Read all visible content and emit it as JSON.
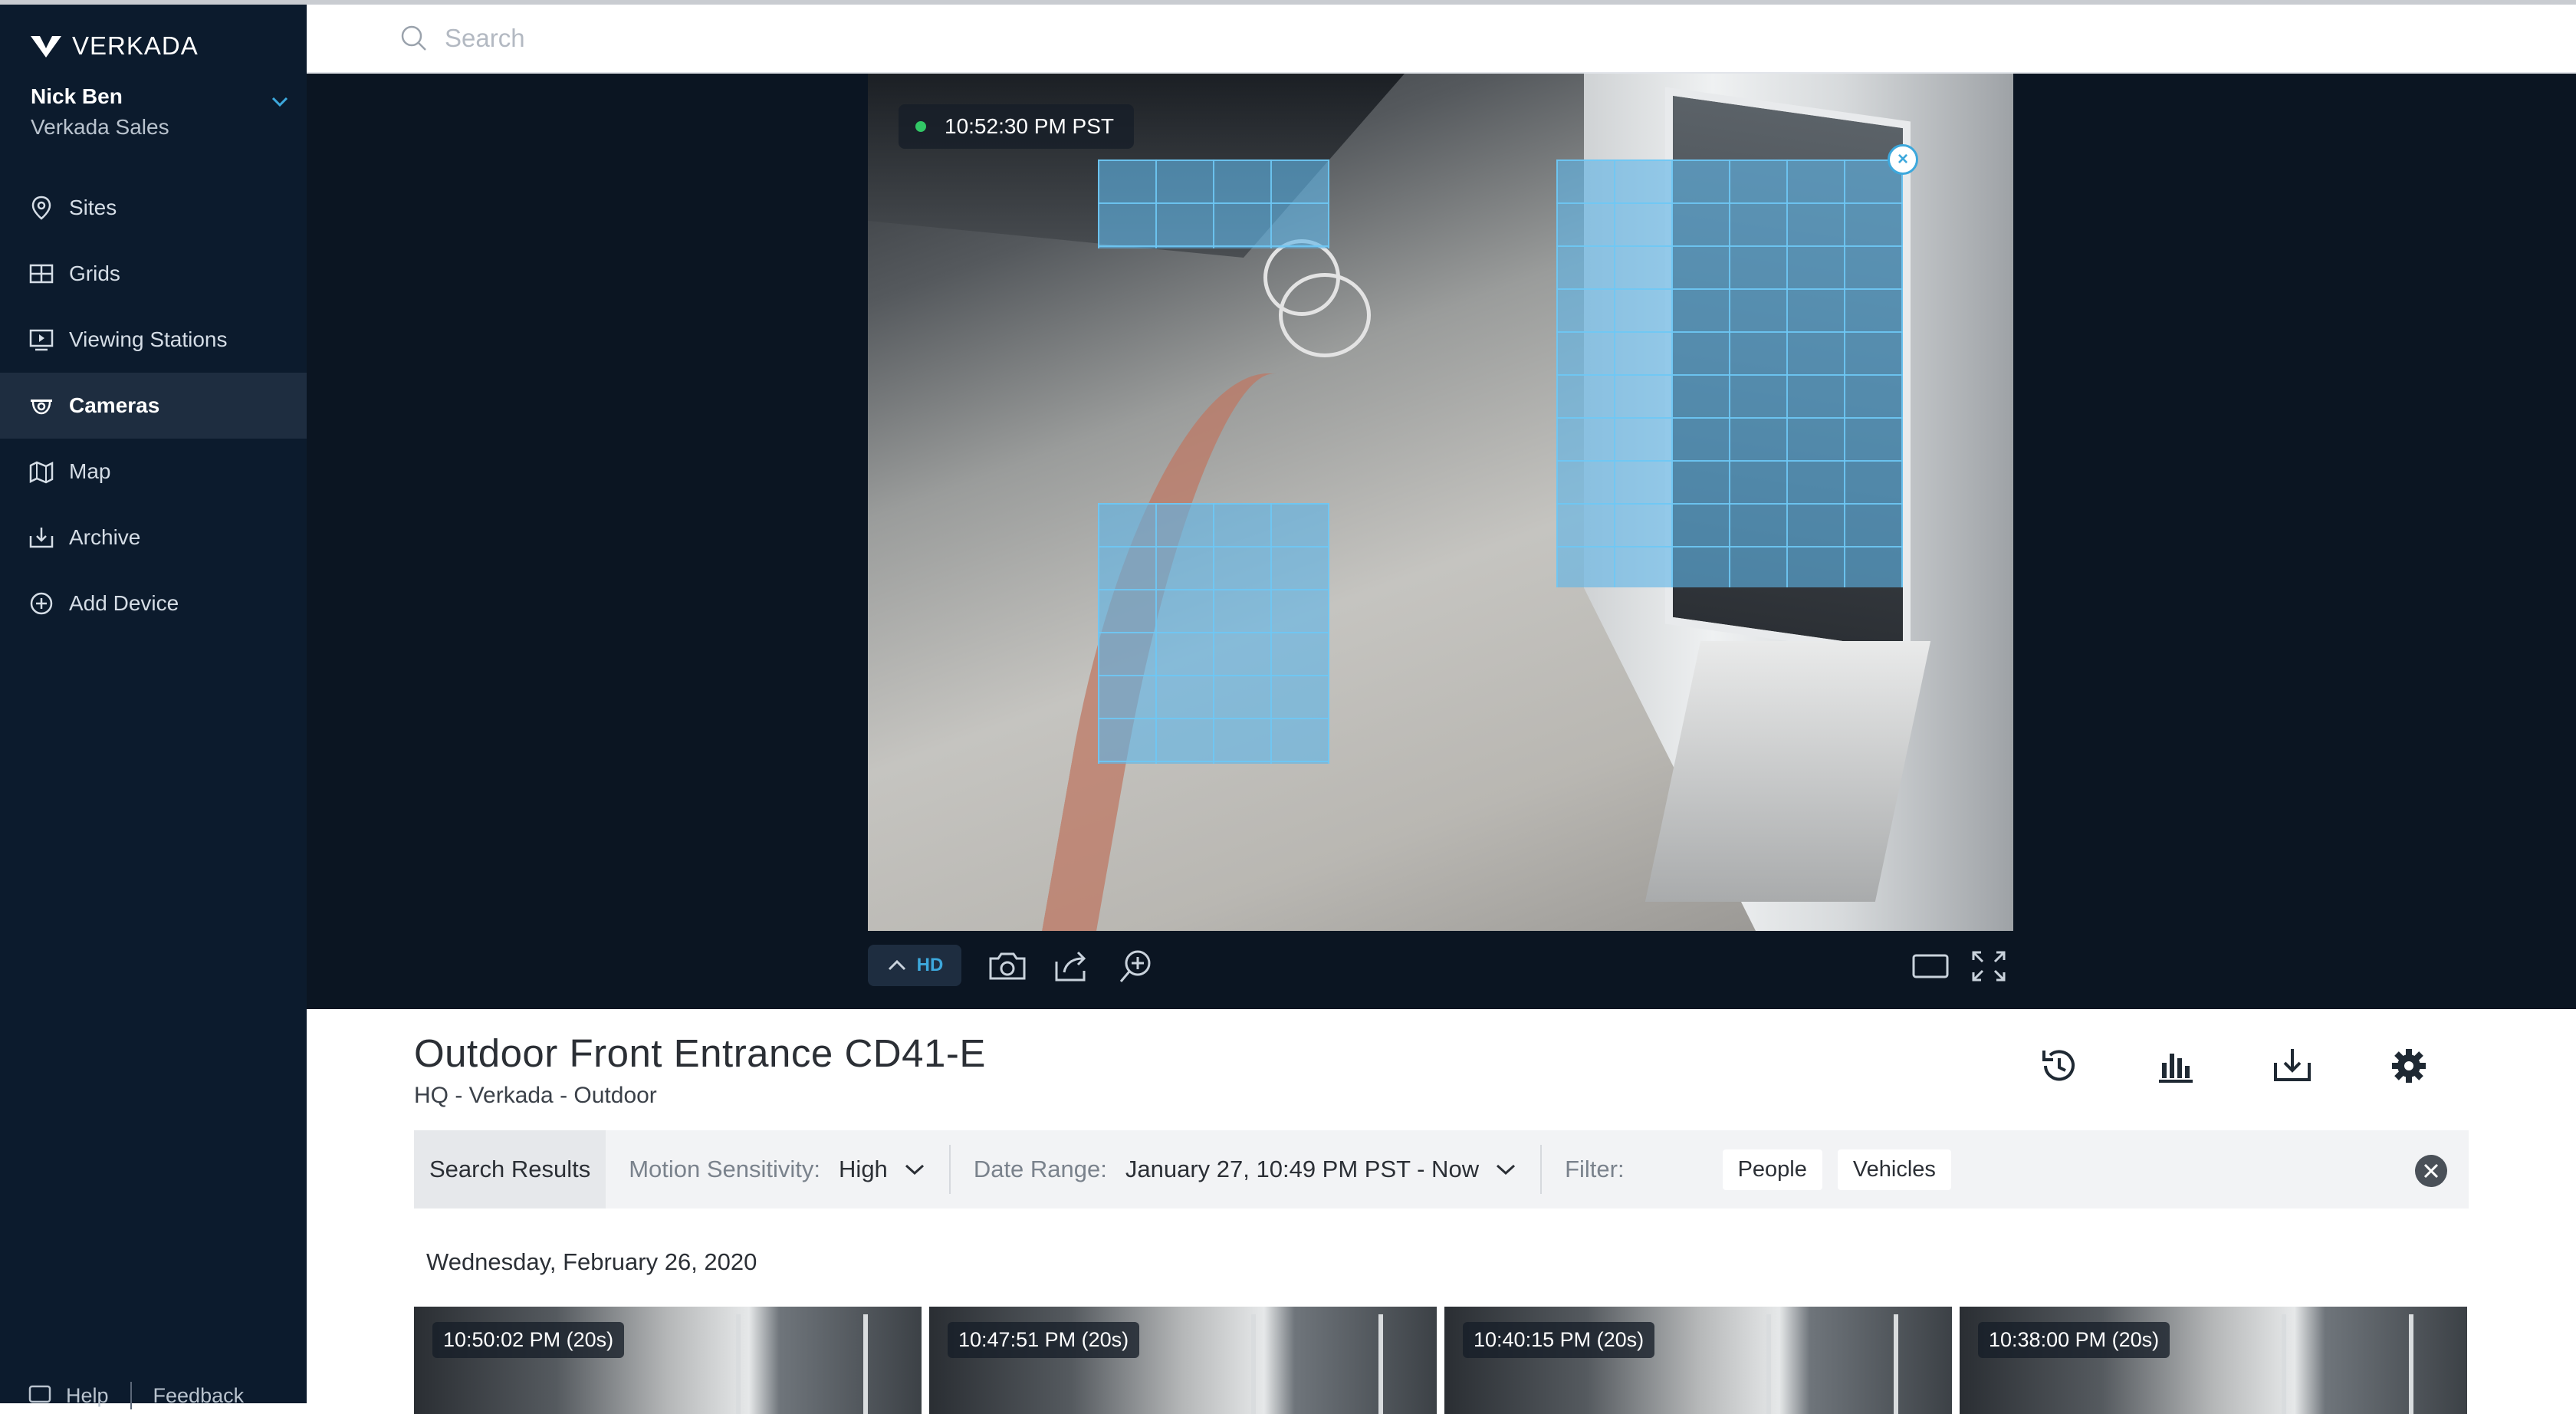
{
  "brand": {
    "name": "VERKADA"
  },
  "user": {
    "name": "Nick Ben",
    "org": "Verkada Sales"
  },
  "nav": {
    "items": [
      {
        "label": "Sites",
        "icon": "map-pin-icon"
      },
      {
        "label": "Grids",
        "icon": "grid-icon"
      },
      {
        "label": "Viewing Stations",
        "icon": "monitor-play-icon"
      },
      {
        "label": "Cameras",
        "icon": "camera-dome-icon",
        "active": true
      },
      {
        "label": "Map",
        "icon": "map-icon"
      },
      {
        "label": "Archive",
        "icon": "archive-icon"
      },
      {
        "label": "Add Device",
        "icon": "plus-circle-icon"
      }
    ]
  },
  "footer": {
    "help": "Help",
    "feedback": "Feedback"
  },
  "search": {
    "placeholder": "Search"
  },
  "video": {
    "timestamp": "10:52:30 PM PST",
    "live_indicator_color": "#32c766",
    "quality": "HD",
    "mask_color": "#60b4e6"
  },
  "camera": {
    "title": "Outdoor Front Entrance CD41-E",
    "subtitle": "HQ - Verkada - Outdoor"
  },
  "actions": [
    "history-icon",
    "analytics-icon",
    "download-icon",
    "settings-icon"
  ],
  "filters": {
    "tab": "Search Results",
    "sensitivity_label": "Motion Sensitivity:",
    "sensitivity_value": "High",
    "date_label": "Date Range:",
    "date_value": "January 27, 10:49 PM PST - Now",
    "filter_label": "Filter:",
    "chips": [
      "People",
      "Vehicles"
    ]
  },
  "results": {
    "date_heading": "Wednesday, February 26, 2020",
    "clips": [
      {
        "label": "10:50:02 PM (20s)"
      },
      {
        "label": "10:47:51 PM (20s)"
      },
      {
        "label": "10:40:15 PM (20s)"
      },
      {
        "label": "10:38:00 PM (20s)"
      }
    ]
  },
  "colors": {
    "sidebar": "#0c1b2d",
    "sidebar_active": "#1e2d40",
    "accent": "#3da8dc"
  }
}
